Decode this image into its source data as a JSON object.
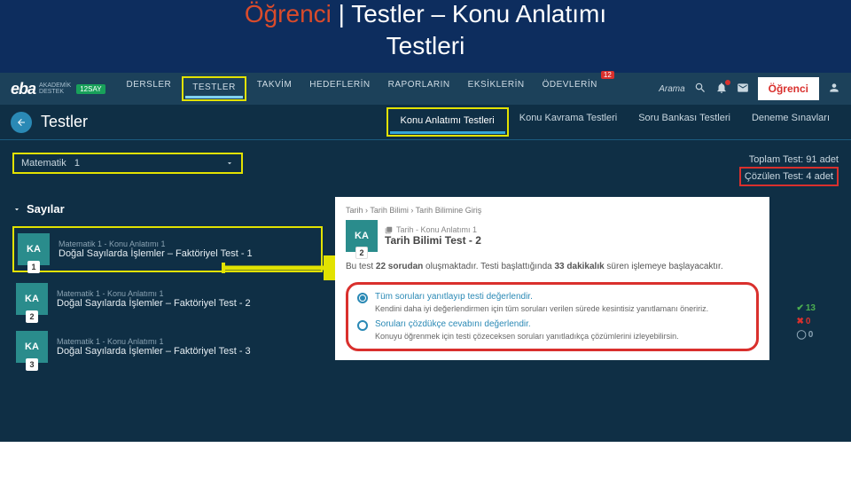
{
  "slide": {
    "accent": "Öğrenci",
    "sep": "|",
    "rest": "Testler – Konu Anlatımı",
    "line2": "Testleri"
  },
  "header": {
    "logo_text": "eba",
    "logo_sub1": "AKADEMİK",
    "logo_sub2": "DESTEK",
    "logo_badge": "12SAY",
    "nav": [
      "DERSLER",
      "TESTLER",
      "TAKVİM",
      "HEDEFLERİN",
      "RAPORLARIN",
      "EKSİKLERİN",
      "ÖDEVLERİN"
    ],
    "nav_active_index": 1,
    "odev_badge": "12",
    "search_label": "Arama",
    "role_button": "Öğrenci"
  },
  "subheader": {
    "title": "Testler",
    "tabs": [
      "Konu Anlatımı Testleri",
      "Konu Kavrama Testleri",
      "Soru Bankası Testleri",
      "Deneme Sınavları"
    ],
    "active_tab_index": 0
  },
  "filter": {
    "subject_label": "Matematik",
    "subject_count": "1",
    "total_tests": "Toplam Test: 91 adet",
    "solved_tests": "Çözülen Test: 4 adet"
  },
  "topic": {
    "name": "Sayılar",
    "items": [
      {
        "meta": "Matematik 1 - Konu Anlatımı 1",
        "title": "Doğal Sayılarda İşlemler – Faktöriyel Test - 1",
        "num": "1"
      },
      {
        "meta": "Matematik 1 - Konu Anlatımı 1",
        "title": "Doğal Sayılarda İşlemler – Faktöriyel Test - 2",
        "num": "2"
      },
      {
        "meta": "Matematik 1 - Konu Anlatımı 1",
        "title": "Doğal Sayılarda İşlemler – Faktöriyel Test - 3",
        "num": "3"
      }
    ]
  },
  "panel": {
    "breadcrumb": "Tarih › Tarih Bilimi › Tarih Bilimine Giriş",
    "tile_label": "KA",
    "tile_num": "2",
    "sub": "Tarih - Konu Anlatımı 1",
    "title": "Tarih Bilimi Test - 2",
    "desc_pre": "Bu test ",
    "desc_q": "22 sorudan",
    "desc_mid": " oluşmaktadır. Testi başlattığında ",
    "desc_min": "33 dakikalık",
    "desc_post": " süren işlemeye başlayacaktır.",
    "opt1_title": "Tüm soruları yanıtlayıp testi değerlendir.",
    "opt1_desc": "Kendini daha iyi değerlendirmen için tüm soruları verilen sürede kesintisiz yanıtlamanı öneririz.",
    "opt2_title": "Soruları çözdükçe cevabını değerlendir.",
    "opt2_desc": "Konuyu öğrenmek için testi çözeceksen soruları yanıtladıkça çözümlerini izleyebilirsin.",
    "stat_correct": "13",
    "stat_wrong": "0",
    "stat_empty": "0"
  }
}
